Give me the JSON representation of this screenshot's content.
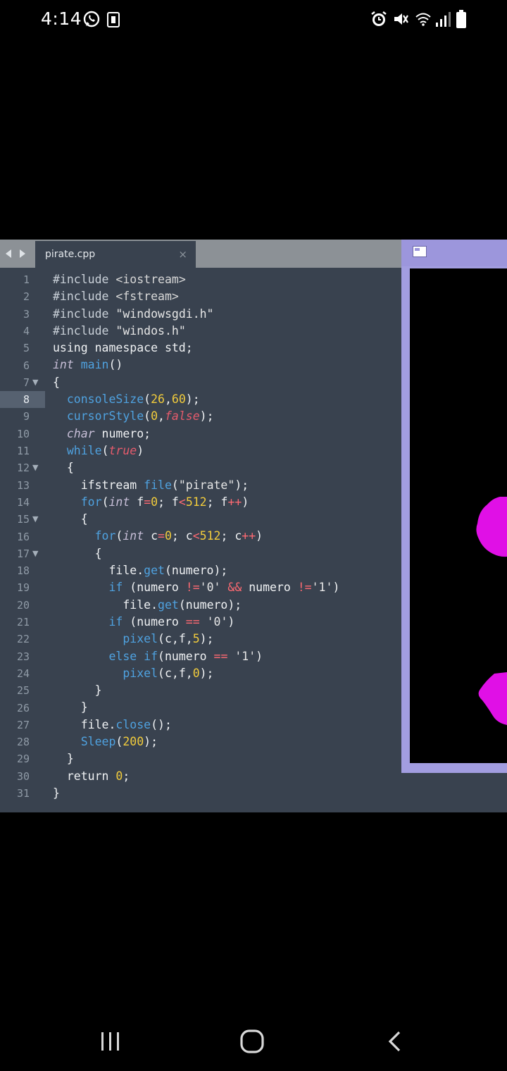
{
  "status_bar": {
    "time": "4:14",
    "left_icons": [
      "whatsapp-icon",
      "notification-card-icon"
    ],
    "right_icons": [
      "alarm-icon",
      "mute-vibrate-icon",
      "wifi-icon",
      "signal-icon",
      "battery-icon"
    ]
  },
  "editor": {
    "tab": {
      "label": "pirate.cpp",
      "close": "×"
    },
    "active_line": 8,
    "fold_lines": [
      7,
      12,
      15,
      17
    ],
    "line_numbers": [
      "1",
      "2",
      "3",
      "4",
      "5",
      "6",
      "7",
      "8",
      "9",
      "10",
      "11",
      "12",
      "13",
      "14",
      "15",
      "16",
      "17",
      "18",
      "19",
      "20",
      "21",
      "22",
      "23",
      "24",
      "25",
      "26",
      "27",
      "28",
      "29",
      "30",
      "31"
    ],
    "code_lines": [
      "#include <iostream>",
      "#include <fstream>",
      "#include \"windowsgdi.h\"",
      "#include \"windos.h\"",
      "using namespace std;",
      "int main()",
      "{",
      "  consoleSize(26,60);",
      "  cursorStyle(0,false);",
      "  char numero;",
      "  while(true)",
      "  {",
      "    ifstream file(\"pirate\");",
      "    for(int f=0; f<512; f++)",
      "    {",
      "      for(int c=0; c<512; c++)",
      "      {",
      "        file.get(numero);",
      "        if (numero !='0' && numero !='1')",
      "          file.get(numero);",
      "        if (numero == '0')",
      "          pixel(c,f,5);",
      "        else if(numero == '1')",
      "          pixel(c,f,0);",
      "      }",
      "    }",
      "    file.close();",
      "    Sleep(200);",
      "  }",
      "  return 0;",
      "}"
    ]
  },
  "console_window": {
    "icon": "console-window-icon",
    "blob_color": "#e010e6"
  },
  "nav_bar": {
    "buttons": [
      "recent-apps-icon",
      "home-icon",
      "back-icon"
    ]
  },
  "colors": {
    "editor_bg": "#39424f",
    "tabbar_bg": "#8c9196",
    "console_frame": "#a29de0",
    "function_blue": "#4fa2e0",
    "number_yellow": "#f2cc3c",
    "bool_red": "#e65b6c"
  }
}
